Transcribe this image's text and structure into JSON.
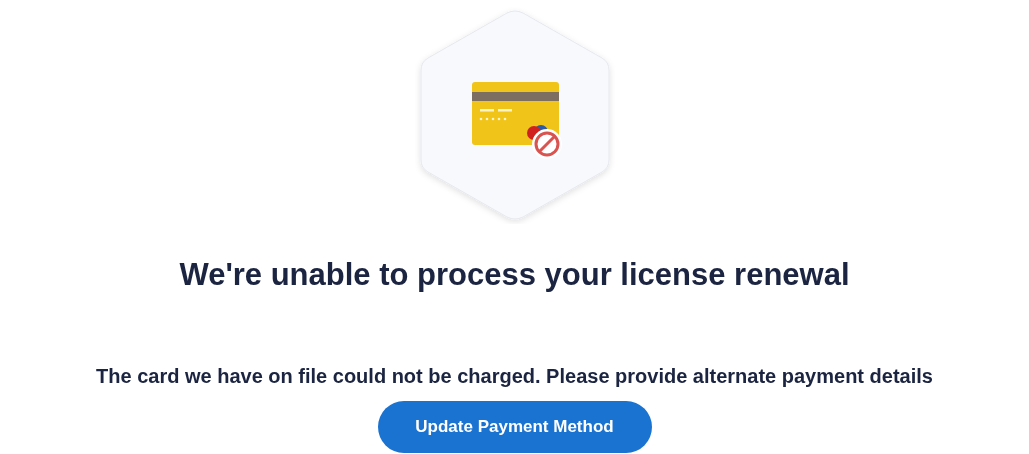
{
  "heading": "We're unable to process your license renewal",
  "message": "The card we have on file could not be charged. Please provide alternate payment details",
  "button": "Update Payment Method"
}
